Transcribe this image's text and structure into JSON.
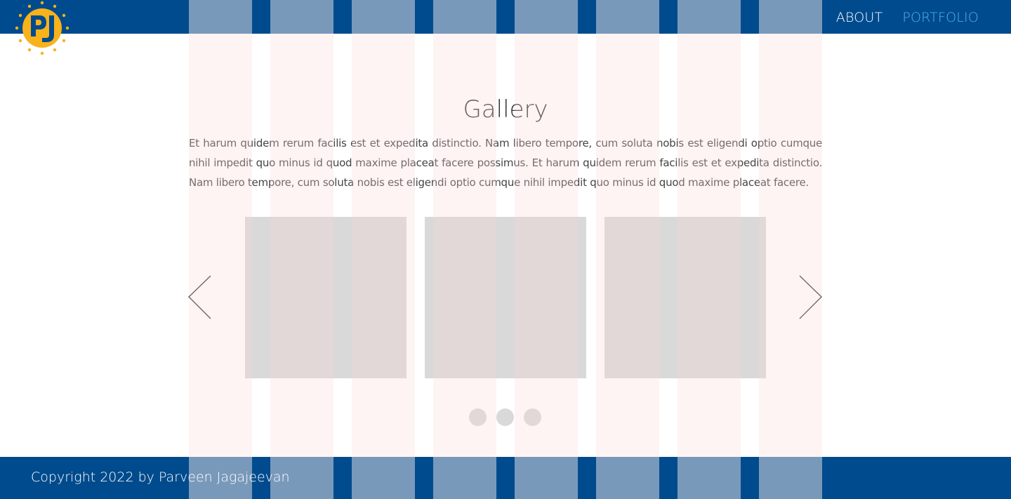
{
  "header": {
    "logo_name": "pj-logo",
    "background_color": "#004b8d",
    "nav": [
      {
        "label": "ABOUT",
        "active": false
      },
      {
        "label": "PORTFOLIO",
        "active": true
      }
    ],
    "active_color": "#4fb3ec"
  },
  "main": {
    "title": "Gallery",
    "intro": "Et harum quidem rerum facilis est et expedita distinctio. Nam libero tempore, cum soluta nobis est eligendi optio cumque nihil impedit quo minus id quod maxime placeat facere possimus. Et harum quidem rerum facilis est et expedita distinctio. Nam libero tempore, cum soluta nobis est eligendi optio cumque nihil impedit quo minus id quod maxime placeat facere."
  },
  "carousel": {
    "prev_icon": "chevron-left-icon",
    "next_icon": "chevron-right-icon",
    "slide_count": 3,
    "dot_count": 3
  },
  "footer": {
    "copyright": "Copyright 2022 by Parveen Jagajeevan"
  },
  "grid_overlay": {
    "columns": 8,
    "color": "#fad7d7"
  }
}
